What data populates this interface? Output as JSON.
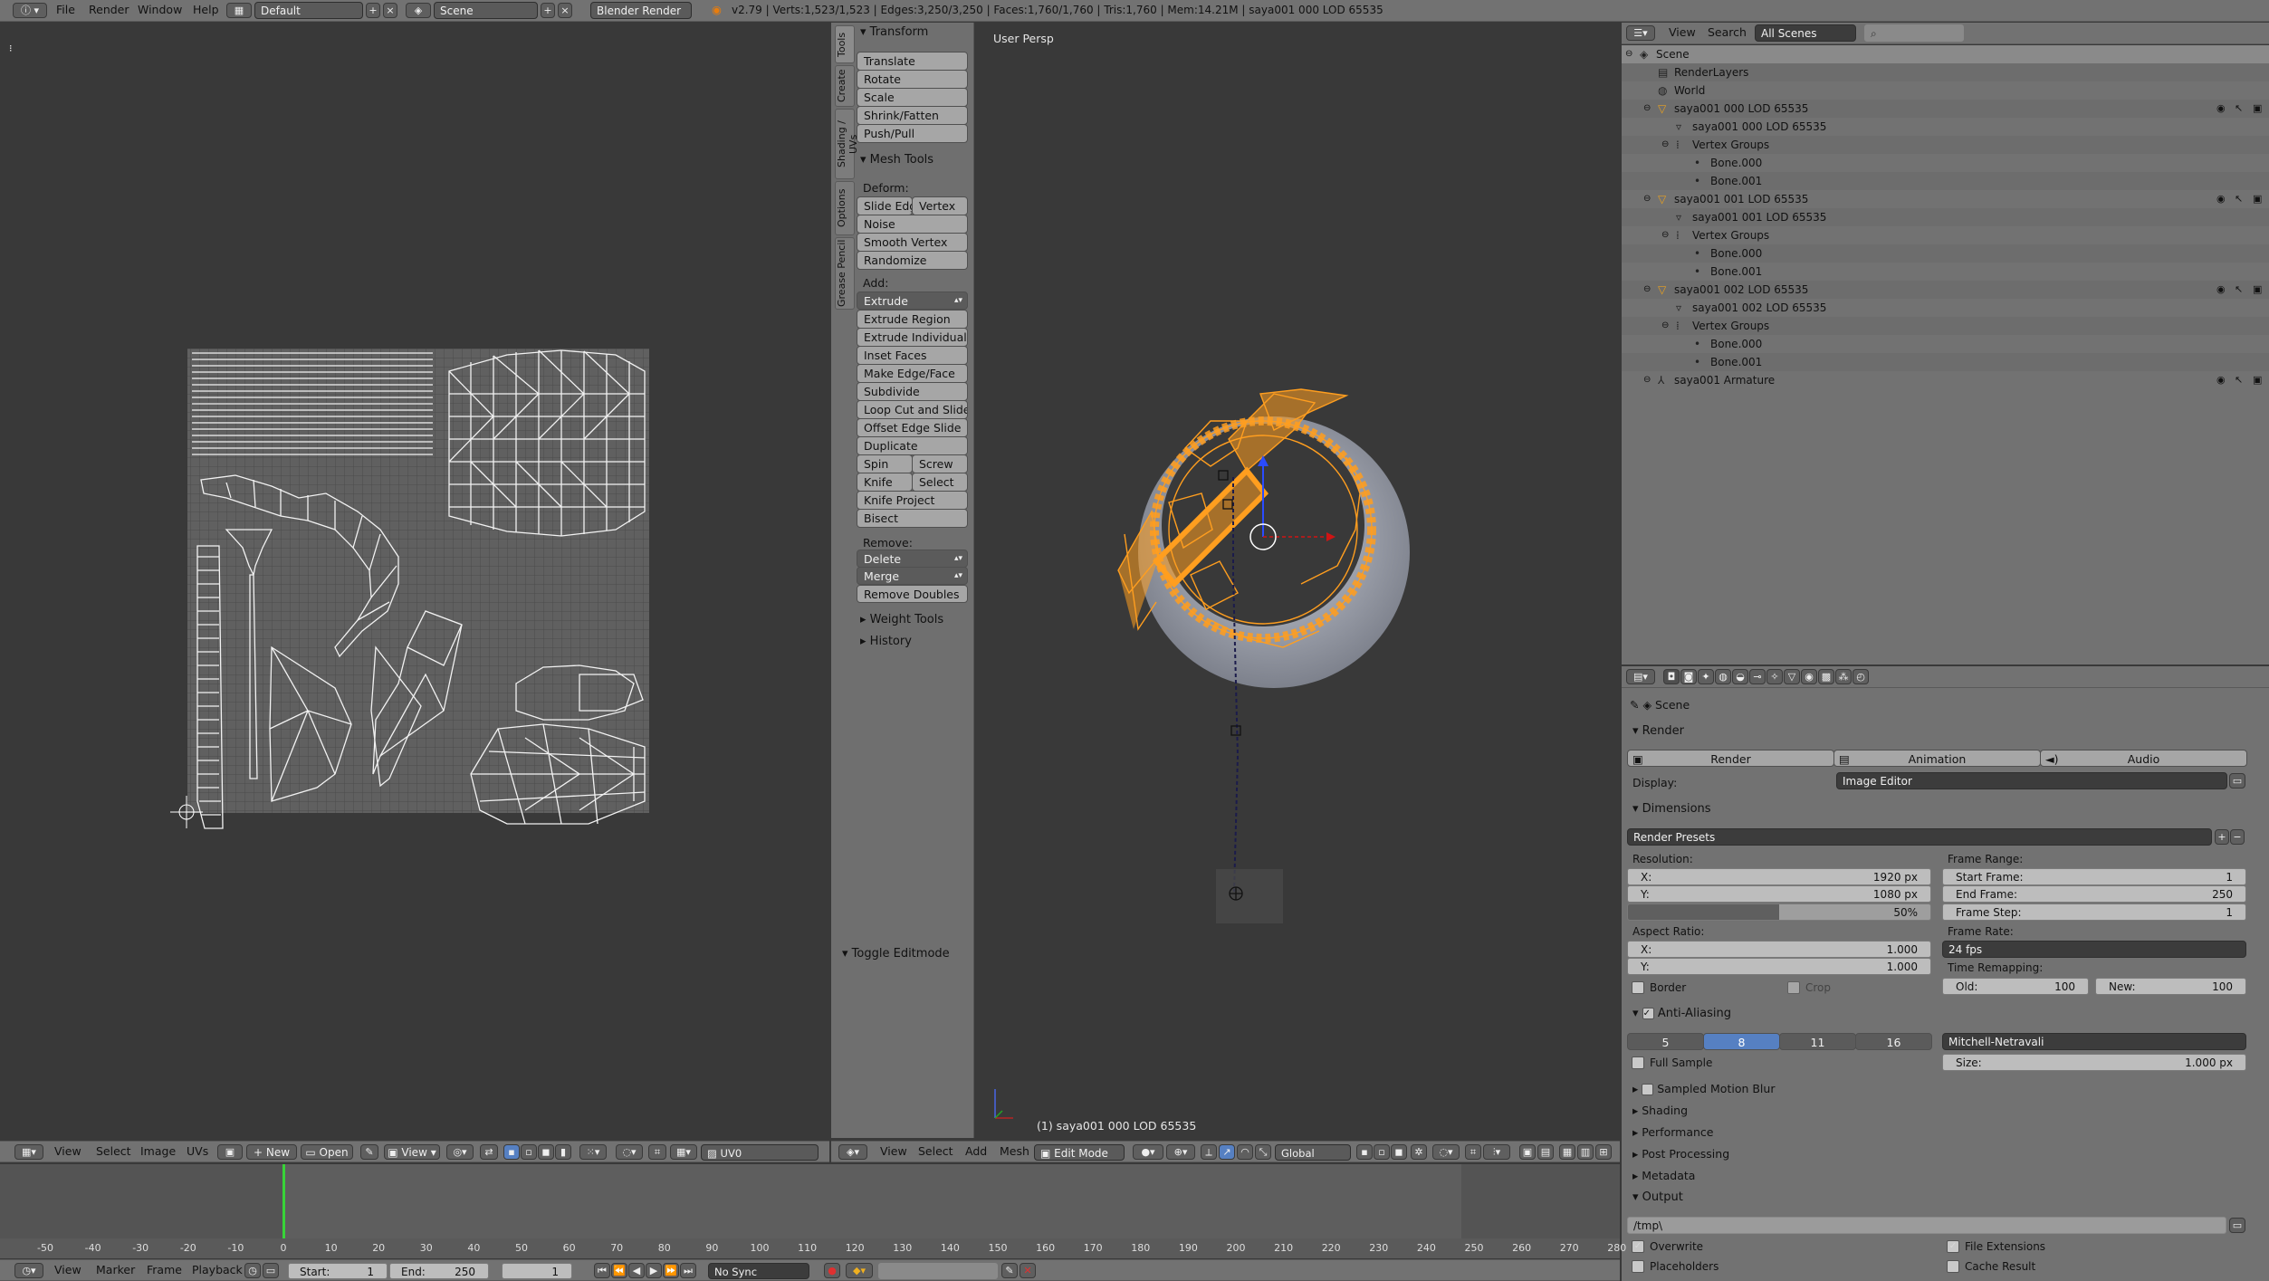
{
  "info_header": {
    "menus": [
      "File",
      "Render",
      "Window",
      "Help"
    ],
    "layout": "Default",
    "scene": "Scene",
    "engine": "Blender Render",
    "stats": "v2.79 | Verts:1,523/1,523 | Edges:3,250/3,250 | Faces:1,760/1,760 | Tris:1,760 | Mem:14.21M | saya001 000 LOD 65535"
  },
  "tool_tabs": [
    "Tools",
    "Create",
    "Shading / UVs",
    "Options",
    "Grease Pencil"
  ],
  "tool_shelf": {
    "transform_title": "Transform",
    "transform": [
      "Translate",
      "Rotate",
      "Scale",
      "Shrink/Fatten",
      "Push/Pull"
    ],
    "mesh_tools_title": "Mesh Tools",
    "deform_label": "Deform:",
    "slide_edge": "Slide Edge",
    "vertex": "Vertex",
    "deform": [
      "Noise",
      "Smooth Vertex",
      "Randomize"
    ],
    "add_label": "Add:",
    "extrude": "Extrude",
    "add": [
      "Extrude Region",
      "Extrude Individual",
      "Inset Faces",
      "Make Edge/Face",
      "Subdivide",
      "Loop Cut and Slide",
      "Offset Edge Slide",
      "Duplicate"
    ],
    "spin": "Spin",
    "screw": "Screw",
    "knife": "Knife",
    "select": "Select",
    "add2": [
      "Knife Project",
      "Bisect"
    ],
    "remove_label": "Remove:",
    "delete": "Delete",
    "merge": "Merge",
    "remove_doubles": "Remove Doubles",
    "weight_tools": "Weight Tools",
    "history": "History",
    "toggle_editmode": "Toggle Editmode"
  },
  "viewport": {
    "title": "User Persp",
    "status": "(1) saya001 000 LOD 65535",
    "menus": [
      "View",
      "Select",
      "Add",
      "Mesh"
    ],
    "mode": "Edit Mode",
    "orientation": "Global"
  },
  "uv_editor": {
    "menus": [
      "View",
      "Select",
      "Image",
      "UVs"
    ],
    "new": "New",
    "open": "Open",
    "view": "View",
    "uvmap": "UV0"
  },
  "outliner": {
    "menus": [
      "View",
      "Search"
    ],
    "filter": "All Scenes",
    "items": [
      {
        "label": "Scene",
        "depth": 0,
        "type": "scene"
      },
      {
        "label": "RenderLayers",
        "depth": 1,
        "type": "renderlayers"
      },
      {
        "label": "World",
        "depth": 1,
        "type": "world"
      },
      {
        "label": "saya001 000 LOD 65535",
        "depth": 1,
        "type": "mesh"
      },
      {
        "label": "saya001 000 LOD 65535",
        "depth": 2,
        "type": "meshdata"
      },
      {
        "label": "Vertex Groups",
        "depth": 2,
        "type": "vgroup"
      },
      {
        "label": "Bone.000",
        "depth": 3,
        "type": "dot"
      },
      {
        "label": "Bone.001",
        "depth": 3,
        "type": "dot"
      },
      {
        "label": "saya001 001 LOD 65535",
        "depth": 1,
        "type": "mesh"
      },
      {
        "label": "saya001 001 LOD 65535",
        "depth": 2,
        "type": "meshdata"
      },
      {
        "label": "Vertex Groups",
        "depth": 2,
        "type": "vgroup"
      },
      {
        "label": "Bone.000",
        "depth": 3,
        "type": "dot"
      },
      {
        "label": "Bone.001",
        "depth": 3,
        "type": "dot"
      },
      {
        "label": "saya001 002 LOD 65535",
        "depth": 1,
        "type": "mesh"
      },
      {
        "label": "saya001 002 LOD 65535",
        "depth": 2,
        "type": "meshdata"
      },
      {
        "label": "Vertex Groups",
        "depth": 2,
        "type": "vgroup"
      },
      {
        "label": "Bone.000",
        "depth": 3,
        "type": "dot"
      },
      {
        "label": "Bone.001",
        "depth": 3,
        "type": "dot"
      },
      {
        "label": "saya001 Armature",
        "depth": 1,
        "type": "armature"
      }
    ]
  },
  "properties": {
    "context": "Scene",
    "render_title": "Render",
    "render_btn": "Render",
    "animation_btn": "Animation",
    "audio_btn": "Audio",
    "display_label": "Display:",
    "display_value": "Image Editor",
    "dimensions_title": "Dimensions",
    "render_presets": "Render Presets",
    "resolution_label": "Resolution:",
    "res_x_label": "X:",
    "res_x": "1920 px",
    "res_y_label": "Y:",
    "res_y": "1080 px",
    "res_pct": "50%",
    "res_pct_value": 0.5,
    "frame_range_label": "Frame Range:",
    "start_frame_label": "Start Frame:",
    "start_frame": "1",
    "end_frame_label": "End Frame:",
    "end_frame": "250",
    "frame_step_label": "Frame Step:",
    "frame_step": "1",
    "aspect_label": "Aspect Ratio:",
    "aspect_x_label": "X:",
    "aspect_x": "1.000",
    "aspect_y_label": "Y:",
    "aspect_y": "1.000",
    "frame_rate_label": "Frame Rate:",
    "frame_rate": "24 fps",
    "border": "Border",
    "crop": "Crop",
    "time_remap_label": "Time Remapping:",
    "old_label": "Old:",
    "old": "100",
    "new_label": "New:",
    "new": "100",
    "aa_title": "Anti-Aliasing",
    "aa_samples": [
      "5",
      "8",
      "11",
      "16"
    ],
    "aa_filter": "Mitchell-Netravali",
    "full_sample": "Full Sample",
    "size_label": "Size:",
    "size": "1.000 px",
    "collapsed": [
      "Sampled Motion Blur",
      "Shading",
      "Performance",
      "Post Processing",
      "Metadata"
    ],
    "output_title": "Output",
    "output_path": "/tmp\\",
    "overwrite": "Overwrite",
    "file_extensions": "File Extensions",
    "placeholders": "Placeholders",
    "cache_result": "Cache Result"
  },
  "timeline": {
    "menus": [
      "View",
      "Marker",
      "Frame",
      "Playback"
    ],
    "start_label": "Start:",
    "start": "1",
    "end_label": "End:",
    "end": "250",
    "current": "1",
    "sync": "No Sync",
    "ticks": [
      "-50",
      "-40",
      "-30",
      "-20",
      "-10",
      "0",
      "10",
      "20",
      "30",
      "40",
      "50",
      "60",
      "70",
      "80",
      "90",
      "100",
      "110",
      "120",
      "130",
      "140",
      "150",
      "160",
      "170",
      "180",
      "190",
      "200",
      "210",
      "220",
      "230",
      "240",
      "250",
      "260",
      "270",
      "280"
    ]
  },
  "colors": {
    "mesh_select": "#ff9e1f",
    "accent_blue": "#5680c2",
    "current_frame": "#38d438"
  }
}
